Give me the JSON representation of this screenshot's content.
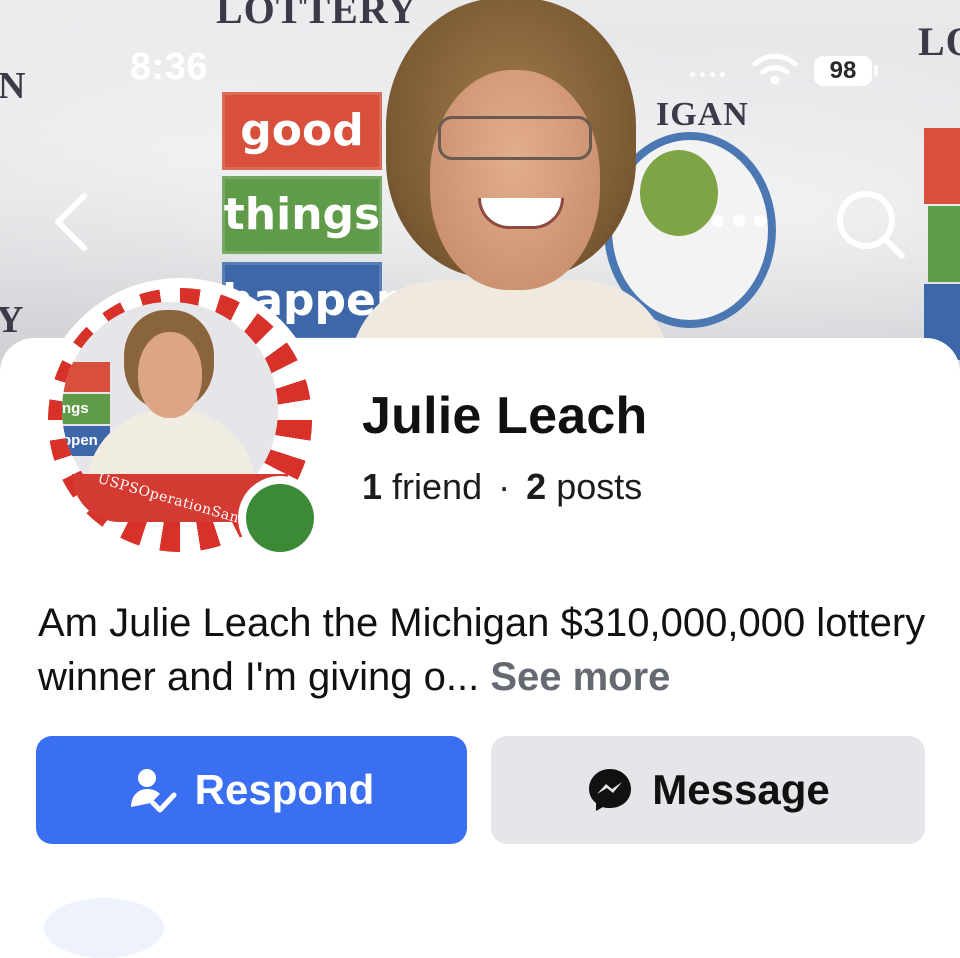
{
  "status_bar": {
    "time": "8:36",
    "battery": "98"
  },
  "cover": {
    "brand_top": "LOTTERY",
    "brand_right": "LO",
    "brand_left_n": "N",
    "brand_left_y": "Y",
    "brand_mid": "IGAN",
    "sign_1": "good",
    "sign_2": "things",
    "sign_3": "happen",
    "colors": {
      "sign_red": "#d8503b",
      "sign_green": "#5f9b48",
      "sign_blue": "#3d67a8"
    }
  },
  "nav": {
    "back_icon": "chevron-left-icon",
    "more_icon": "more-dots-icon",
    "search_icon": "search-icon"
  },
  "profile": {
    "name": "Julie Leach",
    "friends_count": "1",
    "friends_label": "friend",
    "separator": "·",
    "posts_count": "2",
    "posts_label": "posts",
    "avatar_banner": "USPSOperationSanta",
    "avatar_sign_1": "ngs",
    "avatar_sign_2": "ppen",
    "online_status_color": "#3c8a35"
  },
  "bio": {
    "text": "Am Julie Leach the Michigan $310,000,000 lottery winner and I'm giving o...",
    "see_more": "See more"
  },
  "actions": {
    "respond_label": "Respond",
    "respond_icon": "person-check-icon",
    "message_label": "Message",
    "message_icon": "messenger-icon",
    "colors": {
      "respond_bg": "#3a6ff2",
      "message_bg": "#e5e6ea"
    }
  }
}
